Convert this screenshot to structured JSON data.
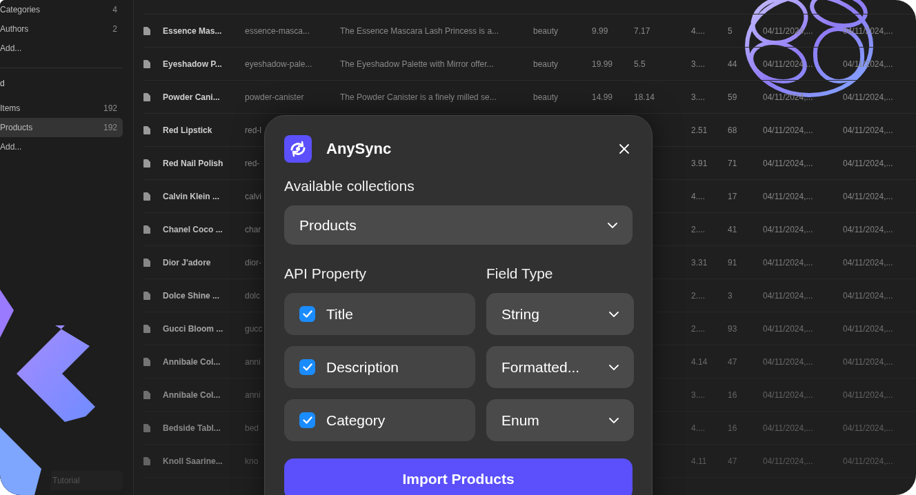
{
  "sidebar": {
    "groups": [
      {
        "items": [
          {
            "label": "Categories",
            "count": "4",
            "selected": false
          },
          {
            "label": "Authors",
            "count": "2",
            "selected": false
          },
          {
            "label": "Add...",
            "selected": false
          }
        ]
      },
      {
        "heading": "d",
        "items": [
          {
            "label": "Items",
            "count": "192",
            "selected": false
          },
          {
            "label": "Products",
            "count": "192",
            "selected": true
          },
          {
            "label": "Add...",
            "selected": false
          }
        ]
      }
    ],
    "footer": "Tutorial"
  },
  "table": {
    "rows": [
      {
        "name": "Essence Mas...",
        "slug": "essence-masca...",
        "description": "The Essence Mascara Lash Princess is a...",
        "category": "beauty",
        "price": "9.99",
        "discount": "7.17",
        "rating": "4....",
        "stock": "5",
        "created": "04/11/2024,...",
        "updated": "04/11/2024,..."
      },
      {
        "name": "Eyeshadow P...",
        "slug": "eyeshadow-pale...",
        "description": "The Eyeshadow Palette with Mirror offer...",
        "category": "beauty",
        "price": "19.99",
        "discount": "5.5",
        "rating": "3....",
        "stock": "44",
        "created": "04/11/2024,...",
        "updated": "04/11/2024,..."
      },
      {
        "name": "Powder Cani...",
        "slug": "powder-canister",
        "description": "The Powder Canister is a finely milled se...",
        "category": "beauty",
        "price": "14.99",
        "discount": "18.14",
        "rating": "3....",
        "stock": "59",
        "created": "04/11/2024,...",
        "updated": "04/11/2024,..."
      },
      {
        "name": "Red Lipstick",
        "slug": "red-l",
        "rating": "2.51",
        "stock": "68",
        "created": "04/11/2024,...",
        "updated": "04/11/2024,..."
      },
      {
        "name": "Red Nail Polish",
        "slug": "red-",
        "rating": "3.91",
        "stock": "71",
        "created": "04/11/2024,...",
        "updated": "04/11/2024,..."
      },
      {
        "name": "Calvin Klein ...",
        "slug": "calvi",
        "rating": "4....",
        "stock": "17",
        "created": "04/11/2024,...",
        "updated": "04/11/2024,..."
      },
      {
        "name": "Chanel Coco ...",
        "slug": "char",
        "rating": "2....",
        "stock": "41",
        "created": "04/11/2024,...",
        "updated": "04/11/2024,..."
      },
      {
        "name": "Dior J'adore",
        "slug": "dior-",
        "rating": "3.31",
        "stock": "91",
        "created": "04/11/2024,...",
        "updated": "04/11/2024,..."
      },
      {
        "name": "Dolce Shine ...",
        "slug": "dolc",
        "rating": "2....",
        "stock": "3",
        "created": "04/11/2024,...",
        "updated": "04/11/2024,..."
      },
      {
        "name": "Gucci Bloom ...",
        "slug": "gucc",
        "rating": "2....",
        "stock": "93",
        "created": "04/11/2024,...",
        "updated": "04/11/2024,..."
      },
      {
        "name": "Annibale Col...",
        "slug": "anni",
        "rating": "4.14",
        "stock": "47",
        "created": "04/11/2024,...",
        "updated": "04/11/2024,..."
      },
      {
        "name": "Annibale Col...",
        "slug": "anni",
        "rating": "3....",
        "stock": "16",
        "created": "04/11/2024,...",
        "updated": "04/11/2024,..."
      },
      {
        "name": "Bedside Tabl...",
        "slug": "bed",
        "rating": "4....",
        "stock": "16",
        "created": "04/11/2024,...",
        "updated": "04/11/2024,..."
      },
      {
        "name": "Knoll Saarine...",
        "slug": "kno",
        "rating": "4.11",
        "stock": "47",
        "created": "04/11/2024,...",
        "updated": "04/11/2024,..."
      }
    ]
  },
  "dialog": {
    "title": "AnySync",
    "collection_label": "Available collections",
    "collection": "Products",
    "property_heading": "API Property",
    "type_heading": "Field Type",
    "fields": [
      {
        "property": "Title",
        "checked": true,
        "type": "String"
      },
      {
        "property": "Description",
        "checked": true,
        "type": "Formatted..."
      },
      {
        "property": "Category",
        "checked": true,
        "type": "Enum"
      }
    ],
    "button": "Import Products"
  }
}
